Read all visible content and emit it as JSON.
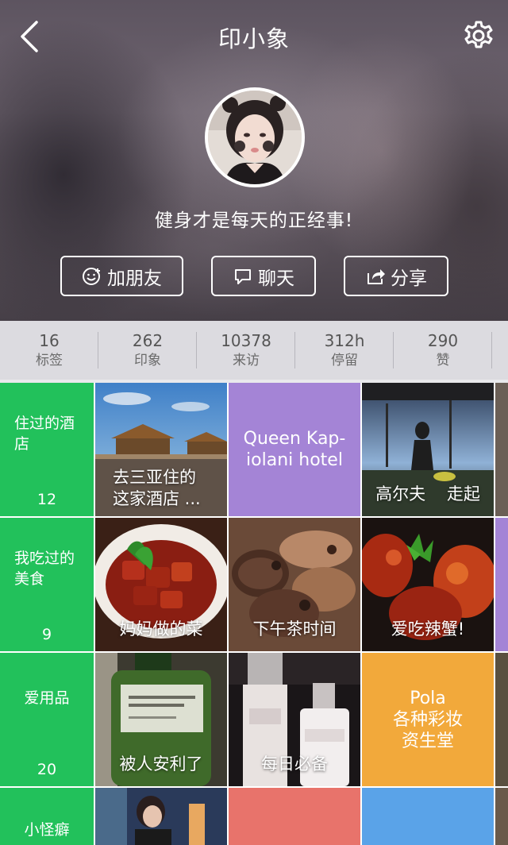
{
  "header": {
    "title": "印小象",
    "back_icon": "chevron-left-icon",
    "settings_icon": "gear-icon",
    "bio": "健身才是每天的正经事!",
    "buttons": {
      "add_friend": "加朋友",
      "chat": "聊天",
      "share": "分享"
    }
  },
  "stats": [
    {
      "value": "16",
      "label": "标签"
    },
    {
      "value": "262",
      "label": "印象"
    },
    {
      "value": "10378",
      "label": "来访"
    },
    {
      "value": "312h",
      "label": "停留"
    },
    {
      "value": "290",
      "label": "赞"
    }
  ],
  "categories": [
    {
      "label": "住过的酒店",
      "count": "12"
    },
    {
      "label": "我吃过的美食",
      "count": "9"
    },
    {
      "label": "爱用品",
      "count": "20"
    },
    {
      "label": "小怪癖",
      "count": ""
    }
  ],
  "tiles": {
    "hotel_sanya": "去三亚住的这家酒店 ...",
    "queen_hotel": "Queen Kap-iolani hotel",
    "golf": "高尔夫    走起",
    "mom_dish": "妈妈做的菜",
    "afternoon_tea": "下午茶时间",
    "crab": "爱吃辣蟹!",
    "recommended": "被人安利了",
    "daily": "每日必备",
    "pola": "Pola\n各种彩妆\n资生堂"
  },
  "colors": {
    "category_green": "#22c15b",
    "purple": "#a484d6",
    "orange": "#f2a93b",
    "salmon": "#e8736b",
    "blue": "#5aa3e8"
  }
}
